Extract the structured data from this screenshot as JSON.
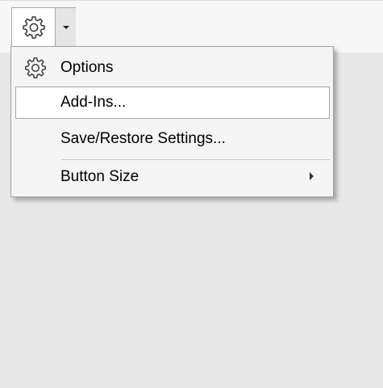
{
  "toolbar": {
    "settings_button": {
      "icon": "gear-icon"
    },
    "dropdown": {
      "icon": "caret-down-icon"
    }
  },
  "menu": {
    "items": [
      {
        "label": "Options",
        "icon": "gear-icon"
      },
      {
        "label": "Add-Ins...",
        "hovered": true
      },
      {
        "label": "Save/Restore Settings..."
      },
      {
        "label": "Button Size",
        "submenu": true,
        "icon": "chevron-right-icon"
      }
    ]
  },
  "colors": {
    "workspace": "#e8e8e8",
    "toolbar": "#f7f7f7",
    "menu_background": "#f5f5f5",
    "menu_border": "#a0a0a0",
    "hover_background": "#ffffff"
  }
}
